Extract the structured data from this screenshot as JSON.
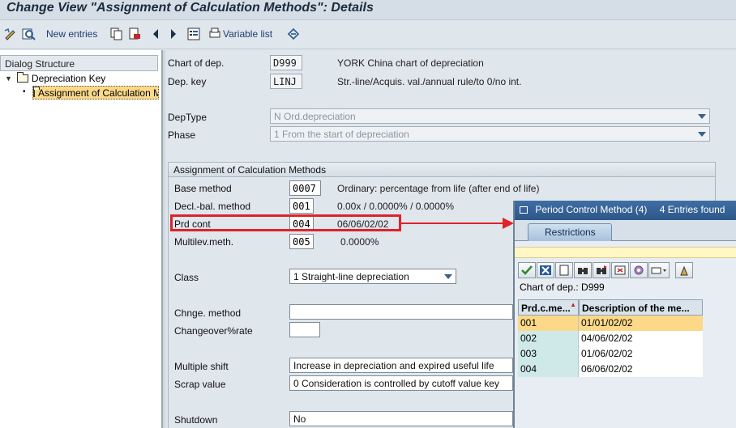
{
  "window": {
    "title": "Change View \"Assignment of Calculation Methods\": Details"
  },
  "toolbar": {
    "new_entries": "New entries",
    "variable_list": "Variable list"
  },
  "dialog_structure": {
    "header": "Dialog Structure",
    "items": [
      {
        "label": "Depreciation Key",
        "expand": "▼"
      },
      {
        "label": "Assignment of Calculation Methods",
        "bullet": "•"
      }
    ]
  },
  "main": {
    "chart_of_dep": {
      "label": "Chart of dep.",
      "value": "D999",
      "desc": "YORK China chart of depreciation"
    },
    "dep_key": {
      "label": "Dep. key",
      "value": "LINJ",
      "desc": "Str.-line/Acquis. val./annual rule/to 0/no int."
    },
    "dep_type": {
      "label": "DepType",
      "value": "N Ord.depreciation"
    },
    "phase": {
      "label": "Phase",
      "value": "1 From the start of depreciation"
    },
    "group_title": "Assignment of Calculation Methods",
    "base_method": {
      "label": "Base method",
      "value": "0007",
      "desc": "Ordinary: percentage from life (after end of life)"
    },
    "decl_bal": {
      "label": "Decl.-bal. method",
      "value": "001",
      "desc": "0.00x / 0.0000% / 0.0000%"
    },
    "prd_cont": {
      "label": "Prd cont",
      "value": "004",
      "desc": "06/06/02/02"
    },
    "multilev": {
      "label": "Multilev.meth.",
      "value": "005",
      "desc": "0.0000%"
    },
    "class": {
      "label": "Class",
      "value": "1 Straight-line depreciation"
    },
    "chnge_method": {
      "label": "Chnge. method",
      "value": ""
    },
    "changeover_rate": {
      "label": "Changeover%rate",
      "value": ""
    },
    "multiple_shift": {
      "label": "Multiple shift",
      "value": "Increase in depreciation and expired useful life"
    },
    "scrap_value": {
      "label": "Scrap value",
      "value": "0 Consideration is controlled by cutoff value key"
    },
    "shutdown": {
      "label": "Shutdown",
      "value": "No"
    }
  },
  "popup": {
    "title": "Period Control Method (4)",
    "entries": "4 Entries found",
    "tab": "Restrictions",
    "chart_info": "Chart of dep.: D999",
    "columns": [
      "Prd.c.me...",
      "Description of the me..."
    ],
    "rows": [
      {
        "code": "001",
        "desc": "01/01/02/02",
        "selected": true
      },
      {
        "code": "002",
        "desc": "04/06/02/02",
        "selected": false
      },
      {
        "code": "003",
        "desc": "01/06/02/02",
        "selected": false
      },
      {
        "code": "004",
        "desc": "06/06/02/02",
        "selected": false
      }
    ]
  },
  "colors": {
    "highlight": "#e0222a",
    "popup_title": "#2d5788",
    "selected_row": "#fbd989"
  }
}
